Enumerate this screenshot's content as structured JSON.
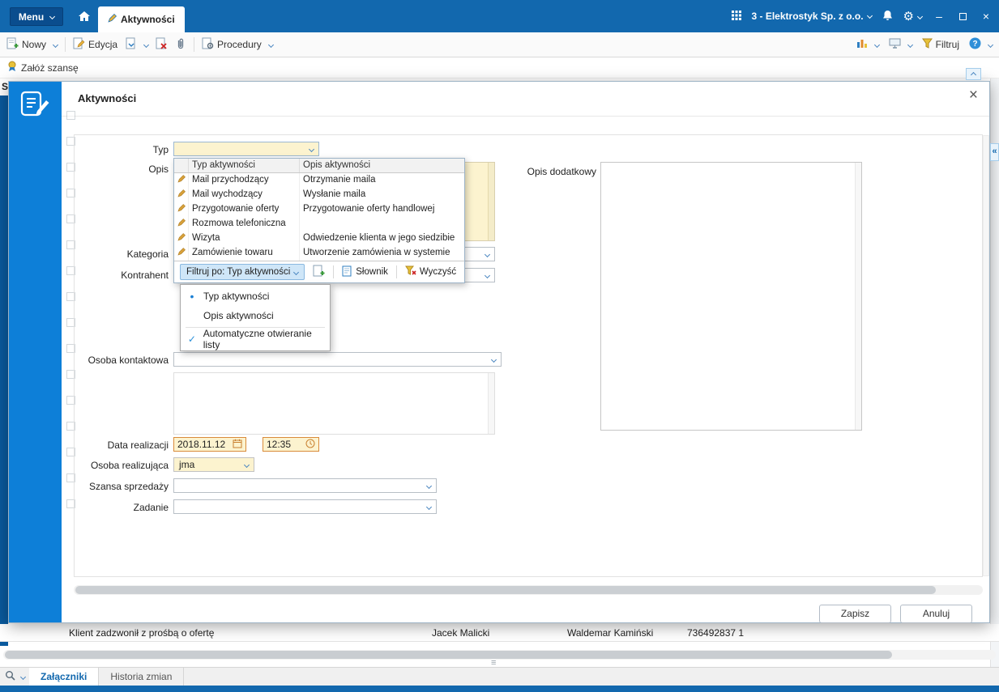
{
  "icons": {
    "gear": "⚙",
    "minimize": "–",
    "close": "×",
    "collapse_left": "«",
    "splitter": "≡",
    "check": "✓",
    "bullet": "•"
  },
  "topbar": {
    "menu_label": "Menu",
    "active_tab": "Aktywności",
    "company": "3 - Elektrostyk Sp. z o.o."
  },
  "toolbar": {
    "nowy": "Nowy",
    "edycja": "Edycja",
    "procedury": "Procedury",
    "filtruj": "Filtruj"
  },
  "subbar": {
    "zaloz_szanse": "Załóż szansę"
  },
  "dialog": {
    "title": "Aktywności",
    "labels": {
      "typ": "Typ",
      "opis": "Opis",
      "kategoria": "Kategoria",
      "kontrahent": "Kontrahent",
      "osoba_kontaktowa": "Osoba kontaktowa",
      "data_realizacji": "Data realizacji",
      "osoba_realizujaca": "Osoba realizująca",
      "szansa_sprzedazy": "Szansa sprzedaży",
      "zadanie": "Zadanie",
      "opis_dodatkowy": "Opis dodatkowy"
    },
    "values": {
      "data": "2018.11.12",
      "czas": "12:35",
      "osoba_realizujaca": "jma"
    },
    "typ_list": {
      "headers": [
        "Typ aktywności",
        "Opis aktywności"
      ],
      "rows": [
        {
          "icon": "pencil",
          "typ": "Mail przychodzący",
          "opis": "Otrzymanie maila"
        },
        {
          "icon": "pencil",
          "typ": "Mail wychodzący",
          "opis": "Wysłanie maila"
        },
        {
          "icon": "pencil",
          "typ": "Przygotowanie oferty",
          "opis": "Przygotowanie oferty handlowej"
        },
        {
          "icon": "pencil",
          "typ": "Rozmowa telefoniczna",
          "opis": ""
        },
        {
          "icon": "pencil",
          "typ": "Wizyta",
          "opis": "Odwiedzenie klienta w jego siedzibie"
        },
        {
          "icon": "pencil",
          "typ": "Zamówienie towaru",
          "opis": "Utworzenie zamówienia w systemie"
        }
      ]
    },
    "filter_bar": {
      "filtruj_po": "Filtruj po: Typ aktywności",
      "slownik": "Słownik",
      "wyczysc": "Wyczyść"
    },
    "filter_menu": {
      "options": [
        "Typ aktywności",
        "Opis aktywności"
      ],
      "selected_index": 0,
      "auto_open": "Automatyczne otwieranie listy"
    },
    "buttons": {
      "zapisz": "Zapisz",
      "anuluj": "Anuluj"
    }
  },
  "background": {
    "partial_text": "S",
    "row": {
      "opis": "Klient zadzwonił z prośbą o ofertę",
      "osoba_kontaktowa": "Jacek Malicki",
      "osoba_realizujaca": "Waldemar Kamiński",
      "telefon": "736492837 1"
    },
    "tabs": {
      "zalaczniki": "Załączniki",
      "historia": "Historia zmian"
    }
  }
}
